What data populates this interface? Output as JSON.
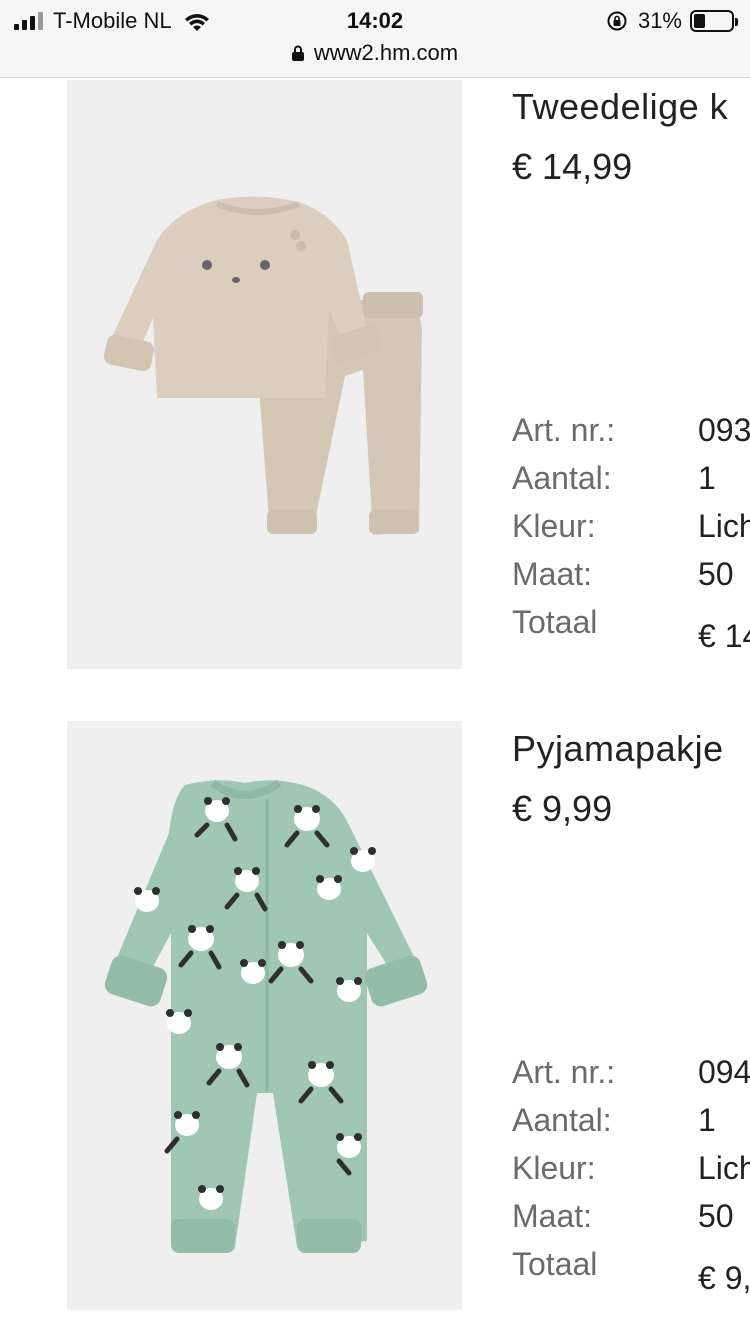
{
  "status_bar": {
    "carrier": "T-Mobile NL",
    "time": "14:02",
    "url": "www2.hm.com",
    "battery": "31%",
    "battery_level": 0.31,
    "icons": [
      "signal-icon",
      "wifi-icon",
      "lock-icon",
      "rotation-lock-icon",
      "battery-icon"
    ]
  },
  "items": [
    {
      "name": "Tweedelige k",
      "price": "€ 14,99",
      "image": "beige-two-piece-set",
      "details": [
        {
          "label": "Art. nr.:",
          "value": "093"
        },
        {
          "label": "Aantal:",
          "value": "1"
        },
        {
          "label": "Kleur:",
          "value": "Lich"
        },
        {
          "label": "Maat:",
          "value": "50"
        },
        {
          "label": "Totaal",
          "value": "€ 14"
        }
      ]
    },
    {
      "name": "Pyjamapakje",
      "price": "€ 9,99",
      "image": "green-panda-pyjama",
      "details": [
        {
          "label": "Art. nr.:",
          "value": "094"
        },
        {
          "label": "Aantal:",
          "value": "1"
        },
        {
          "label": "Kleur:",
          "value": "Lich"
        },
        {
          "label": "Maat:",
          "value": "50"
        },
        {
          "label": "Totaal",
          "value": "€ 9,"
        }
      ]
    }
  ],
  "colors": {
    "photo_bg": "#efefef",
    "beige": "#d8cbbb",
    "mint": "#9fc7b4"
  }
}
